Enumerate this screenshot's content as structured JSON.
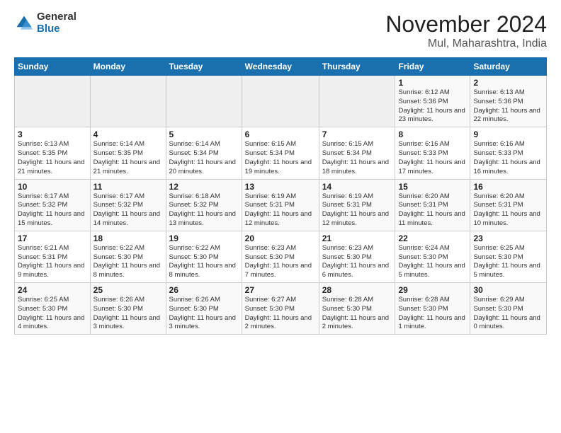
{
  "header": {
    "logo_general": "General",
    "logo_blue": "Blue",
    "month_title": "November 2024",
    "location": "Mul, Maharashtra, India"
  },
  "weekdays": [
    "Sunday",
    "Monday",
    "Tuesday",
    "Wednesday",
    "Thursday",
    "Friday",
    "Saturday"
  ],
  "weeks": [
    [
      {
        "day": "",
        "info": ""
      },
      {
        "day": "",
        "info": ""
      },
      {
        "day": "",
        "info": ""
      },
      {
        "day": "",
        "info": ""
      },
      {
        "day": "",
        "info": ""
      },
      {
        "day": "1",
        "info": "Sunrise: 6:12 AM\nSunset: 5:36 PM\nDaylight: 11 hours\nand 23 minutes."
      },
      {
        "day": "2",
        "info": "Sunrise: 6:13 AM\nSunset: 5:36 PM\nDaylight: 11 hours\nand 22 minutes."
      }
    ],
    [
      {
        "day": "3",
        "info": "Sunrise: 6:13 AM\nSunset: 5:35 PM\nDaylight: 11 hours\nand 21 minutes."
      },
      {
        "day": "4",
        "info": "Sunrise: 6:14 AM\nSunset: 5:35 PM\nDaylight: 11 hours\nand 21 minutes."
      },
      {
        "day": "5",
        "info": "Sunrise: 6:14 AM\nSunset: 5:34 PM\nDaylight: 11 hours\nand 20 minutes."
      },
      {
        "day": "6",
        "info": "Sunrise: 6:15 AM\nSunset: 5:34 PM\nDaylight: 11 hours\nand 19 minutes."
      },
      {
        "day": "7",
        "info": "Sunrise: 6:15 AM\nSunset: 5:34 PM\nDaylight: 11 hours\nand 18 minutes."
      },
      {
        "day": "8",
        "info": "Sunrise: 6:16 AM\nSunset: 5:33 PM\nDaylight: 11 hours\nand 17 minutes."
      },
      {
        "day": "9",
        "info": "Sunrise: 6:16 AM\nSunset: 5:33 PM\nDaylight: 11 hours\nand 16 minutes."
      }
    ],
    [
      {
        "day": "10",
        "info": "Sunrise: 6:17 AM\nSunset: 5:32 PM\nDaylight: 11 hours\nand 15 minutes."
      },
      {
        "day": "11",
        "info": "Sunrise: 6:17 AM\nSunset: 5:32 PM\nDaylight: 11 hours\nand 14 minutes."
      },
      {
        "day": "12",
        "info": "Sunrise: 6:18 AM\nSunset: 5:32 PM\nDaylight: 11 hours\nand 13 minutes."
      },
      {
        "day": "13",
        "info": "Sunrise: 6:19 AM\nSunset: 5:31 PM\nDaylight: 11 hours\nand 12 minutes."
      },
      {
        "day": "14",
        "info": "Sunrise: 6:19 AM\nSunset: 5:31 PM\nDaylight: 11 hours\nand 12 minutes."
      },
      {
        "day": "15",
        "info": "Sunrise: 6:20 AM\nSunset: 5:31 PM\nDaylight: 11 hours\nand 11 minutes."
      },
      {
        "day": "16",
        "info": "Sunrise: 6:20 AM\nSunset: 5:31 PM\nDaylight: 11 hours\nand 10 minutes."
      }
    ],
    [
      {
        "day": "17",
        "info": "Sunrise: 6:21 AM\nSunset: 5:31 PM\nDaylight: 11 hours\nand 9 minutes."
      },
      {
        "day": "18",
        "info": "Sunrise: 6:22 AM\nSunset: 5:30 PM\nDaylight: 11 hours\nand 8 minutes."
      },
      {
        "day": "19",
        "info": "Sunrise: 6:22 AM\nSunset: 5:30 PM\nDaylight: 11 hours\nand 8 minutes."
      },
      {
        "day": "20",
        "info": "Sunrise: 6:23 AM\nSunset: 5:30 PM\nDaylight: 11 hours\nand 7 minutes."
      },
      {
        "day": "21",
        "info": "Sunrise: 6:23 AM\nSunset: 5:30 PM\nDaylight: 11 hours\nand 6 minutes."
      },
      {
        "day": "22",
        "info": "Sunrise: 6:24 AM\nSunset: 5:30 PM\nDaylight: 11 hours\nand 5 minutes."
      },
      {
        "day": "23",
        "info": "Sunrise: 6:25 AM\nSunset: 5:30 PM\nDaylight: 11 hours\nand 5 minutes."
      }
    ],
    [
      {
        "day": "24",
        "info": "Sunrise: 6:25 AM\nSunset: 5:30 PM\nDaylight: 11 hours\nand 4 minutes."
      },
      {
        "day": "25",
        "info": "Sunrise: 6:26 AM\nSunset: 5:30 PM\nDaylight: 11 hours\nand 3 minutes."
      },
      {
        "day": "26",
        "info": "Sunrise: 6:26 AM\nSunset: 5:30 PM\nDaylight: 11 hours\nand 3 minutes."
      },
      {
        "day": "27",
        "info": "Sunrise: 6:27 AM\nSunset: 5:30 PM\nDaylight: 11 hours\nand 2 minutes."
      },
      {
        "day": "28",
        "info": "Sunrise: 6:28 AM\nSunset: 5:30 PM\nDaylight: 11 hours\nand 2 minutes."
      },
      {
        "day": "29",
        "info": "Sunrise: 6:28 AM\nSunset: 5:30 PM\nDaylight: 11 hours\nand 1 minute."
      },
      {
        "day": "30",
        "info": "Sunrise: 6:29 AM\nSunset: 5:30 PM\nDaylight: 11 hours\nand 0 minutes."
      }
    ]
  ]
}
